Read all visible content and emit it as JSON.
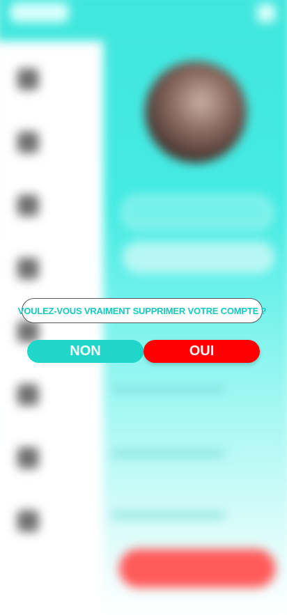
{
  "dialog": {
    "question": "VOULEZ-VOUS VRAIMENT SUPPRIMER VOTRE COMPTE ?",
    "no_label": "NON",
    "yes_label": "OUI"
  },
  "colors": {
    "accent_teal": "#1fd6c8",
    "danger_red": "#ff0000",
    "question_text": "#18c7c0"
  },
  "background": {
    "blurred": true,
    "icons": [
      "app-logo",
      "menu-icon",
      "avatar",
      "sidebar-icons"
    ]
  }
}
